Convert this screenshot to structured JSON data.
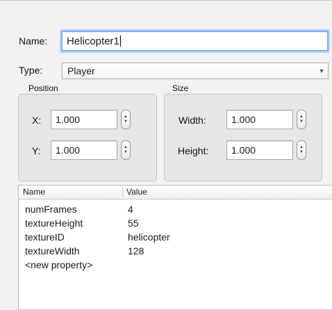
{
  "name_field": {
    "label": "Name:",
    "value": "Helicopter1"
  },
  "type_field": {
    "label": "Type:",
    "value": "Player"
  },
  "position": {
    "title": "Position",
    "x": {
      "label": "X:",
      "value": "1.000"
    },
    "y": {
      "label": "Y:",
      "value": "1.000"
    }
  },
  "size": {
    "title": "Size",
    "width": {
      "label": "Width:",
      "value": "1.000"
    },
    "height": {
      "label": "Height:",
      "value": "1.000"
    }
  },
  "properties": {
    "headers": {
      "name": "Name",
      "value": "Value"
    },
    "rows": [
      {
        "name": "numFrames",
        "value": "4"
      },
      {
        "name": "textureHeight",
        "value": "55"
      },
      {
        "name": "textureID",
        "value": "helicopter"
      },
      {
        "name": "textureWidth",
        "value": "128"
      },
      {
        "name": "<new property>",
        "value": ""
      }
    ]
  },
  "icons": {
    "stepper": "stepper-arrows-icon",
    "dropdown": "chevron-down-icon"
  },
  "colors": {
    "focus_ring": "#7eaef0",
    "background": "#f1f1f1",
    "group_box": "#e6e6e6"
  }
}
